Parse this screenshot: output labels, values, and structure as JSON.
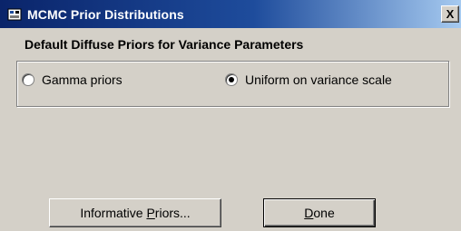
{
  "window": {
    "title": "MCMC Prior Distributions",
    "close_label": "X"
  },
  "group": {
    "legend": "Default Diffuse Priors for Variance Parameters",
    "options": [
      {
        "label": "Gamma priors",
        "checked": false
      },
      {
        "label": "Uniform on variance scale",
        "checked": true
      }
    ]
  },
  "buttons": {
    "informative_priors": {
      "before": "Informative ",
      "mnemonic": "P",
      "after": "riors..."
    },
    "done": {
      "before": "",
      "mnemonic": "D",
      "after": "one"
    }
  }
}
